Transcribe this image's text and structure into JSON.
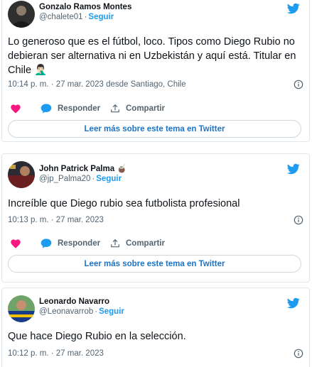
{
  "tweets": [
    {
      "name": "Gonzalo Ramos Montes",
      "handle": "@chalete01",
      "follow": "Seguir",
      "text": "Lo generoso que es el fútbol, loco. Tipos como Diego Rubio no debieran ser alternativa ni en Uzbekistán y aquí está. Titular en Chile 🤦🏻‍♂️",
      "time": "10:14 p. m. · 27 mar. 2023 desde Santiago, Chile",
      "reply": "Responder",
      "share": "Compartir",
      "more": "Leer más sobre este tema en Twitter",
      "icons": [
        "twitter-bird-icon",
        "info-icon",
        "heart-icon",
        "reply-icon",
        "share-icon"
      ]
    },
    {
      "name": "John Patrick Palma 🧉",
      "handle": "@jp_Palma20",
      "follow": "Seguir",
      "text": "Increíble que Diego rubio sea futbolista profesional",
      "time": "10:13 p. m. · 27 mar. 2023",
      "reply": "Responder",
      "share": "Compartir",
      "more": "Leer más sobre este tema en Twitter"
    },
    {
      "name": "Leonardo Navarro",
      "handle": "@Leonavarrob",
      "follow": "Seguir",
      "text": "Que hace Diego Rubio en la selección.",
      "time": "10:12 p. m. · 27 mar. 2023"
    }
  ],
  "colors": {
    "twitter_blue": "#1d9bf0",
    "like_pink": "#f91880",
    "link_blue": "#1d74c7",
    "muted_text": "#536471",
    "border": "#e1e8ed"
  }
}
